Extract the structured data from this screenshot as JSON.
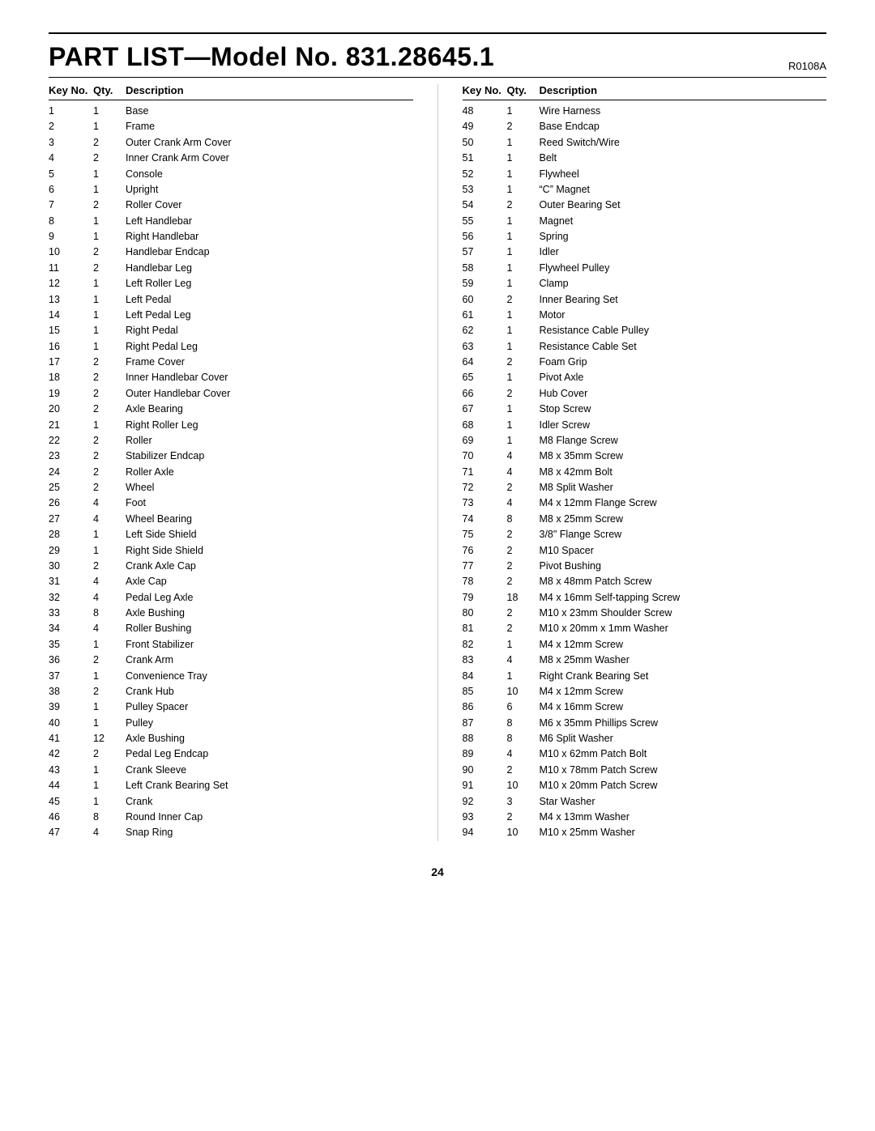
{
  "header": {
    "title": "PART LIST—Model No. 831.28645.1",
    "code": "R0108A"
  },
  "columns": {
    "key_no_label": "Key No.",
    "qty_label": "Qty.",
    "desc_label": "Description"
  },
  "left_parts": [
    {
      "key": "1",
      "qty": "1",
      "desc": "Base"
    },
    {
      "key": "2",
      "qty": "1",
      "desc": "Frame"
    },
    {
      "key": "3",
      "qty": "2",
      "desc": "Outer Crank Arm Cover"
    },
    {
      "key": "4",
      "qty": "2",
      "desc": "Inner Crank Arm Cover"
    },
    {
      "key": "5",
      "qty": "1",
      "desc": "Console"
    },
    {
      "key": "6",
      "qty": "1",
      "desc": "Upright"
    },
    {
      "key": "7",
      "qty": "2",
      "desc": "Roller Cover"
    },
    {
      "key": "8",
      "qty": "1",
      "desc": "Left Handlebar"
    },
    {
      "key": "9",
      "qty": "1",
      "desc": "Right Handlebar"
    },
    {
      "key": "10",
      "qty": "2",
      "desc": "Handlebar Endcap"
    },
    {
      "key": "11",
      "qty": "2",
      "desc": "Handlebar Leg"
    },
    {
      "key": "12",
      "qty": "1",
      "desc": "Left Roller Leg"
    },
    {
      "key": "13",
      "qty": "1",
      "desc": "Left Pedal"
    },
    {
      "key": "14",
      "qty": "1",
      "desc": "Left Pedal Leg"
    },
    {
      "key": "15",
      "qty": "1",
      "desc": "Right Pedal"
    },
    {
      "key": "16",
      "qty": "1",
      "desc": "Right Pedal Leg"
    },
    {
      "key": "17",
      "qty": "2",
      "desc": "Frame Cover"
    },
    {
      "key": "18",
      "qty": "2",
      "desc": "Inner Handlebar Cover"
    },
    {
      "key": "19",
      "qty": "2",
      "desc": "Outer Handlebar Cover"
    },
    {
      "key": "20",
      "qty": "2",
      "desc": "Axle Bearing"
    },
    {
      "key": "21",
      "qty": "1",
      "desc": "Right Roller Leg"
    },
    {
      "key": "22",
      "qty": "2",
      "desc": "Roller"
    },
    {
      "key": "23",
      "qty": "2",
      "desc": "Stabilizer Endcap"
    },
    {
      "key": "24",
      "qty": "2",
      "desc": "Roller Axle"
    },
    {
      "key": "25",
      "qty": "2",
      "desc": "Wheel"
    },
    {
      "key": "26",
      "qty": "4",
      "desc": "Foot"
    },
    {
      "key": "27",
      "qty": "4",
      "desc": "Wheel Bearing"
    },
    {
      "key": "28",
      "qty": "1",
      "desc": "Left Side Shield"
    },
    {
      "key": "29",
      "qty": "1",
      "desc": "Right Side Shield"
    },
    {
      "key": "30",
      "qty": "2",
      "desc": "Crank Axle Cap"
    },
    {
      "key": "31",
      "qty": "4",
      "desc": "Axle Cap"
    },
    {
      "key": "32",
      "qty": "4",
      "desc": "Pedal Leg Axle"
    },
    {
      "key": "33",
      "qty": "8",
      "desc": "Axle Bushing"
    },
    {
      "key": "34",
      "qty": "4",
      "desc": "Roller Bushing"
    },
    {
      "key": "35",
      "qty": "1",
      "desc": "Front Stabilizer"
    },
    {
      "key": "36",
      "qty": "2",
      "desc": "Crank Arm"
    },
    {
      "key": "37",
      "qty": "1",
      "desc": "Convenience Tray"
    },
    {
      "key": "38",
      "qty": "2",
      "desc": "Crank Hub"
    },
    {
      "key": "39",
      "qty": "1",
      "desc": "Pulley Spacer"
    },
    {
      "key": "40",
      "qty": "1",
      "desc": "Pulley"
    },
    {
      "key": "41",
      "qty": "12",
      "desc": "Axle Bushing"
    },
    {
      "key": "42",
      "qty": "2",
      "desc": "Pedal Leg Endcap"
    },
    {
      "key": "43",
      "qty": "1",
      "desc": "Crank Sleeve"
    },
    {
      "key": "44",
      "qty": "1",
      "desc": "Left Crank Bearing Set"
    },
    {
      "key": "45",
      "qty": "1",
      "desc": "Crank"
    },
    {
      "key": "46",
      "qty": "8",
      "desc": "Round Inner Cap"
    },
    {
      "key": "47",
      "qty": "4",
      "desc": "Snap Ring"
    }
  ],
  "right_parts": [
    {
      "key": "48",
      "qty": "1",
      "desc": "Wire Harness"
    },
    {
      "key": "49",
      "qty": "2",
      "desc": "Base Endcap"
    },
    {
      "key": "50",
      "qty": "1",
      "desc": "Reed Switch/Wire"
    },
    {
      "key": "51",
      "qty": "1",
      "desc": "Belt"
    },
    {
      "key": "52",
      "qty": "1",
      "desc": "Flywheel"
    },
    {
      "key": "53",
      "qty": "1",
      "desc": "“C” Magnet"
    },
    {
      "key": "54",
      "qty": "2",
      "desc": "Outer Bearing Set"
    },
    {
      "key": "55",
      "qty": "1",
      "desc": "Magnet"
    },
    {
      "key": "56",
      "qty": "1",
      "desc": "Spring"
    },
    {
      "key": "57",
      "qty": "1",
      "desc": "Idler"
    },
    {
      "key": "58",
      "qty": "1",
      "desc": "Flywheel Pulley"
    },
    {
      "key": "59",
      "qty": "1",
      "desc": "Clamp"
    },
    {
      "key": "60",
      "qty": "2",
      "desc": "Inner Bearing Set"
    },
    {
      "key": "61",
      "qty": "1",
      "desc": "Motor"
    },
    {
      "key": "62",
      "qty": "1",
      "desc": "Resistance Cable Pulley"
    },
    {
      "key": "63",
      "qty": "1",
      "desc": "Resistance Cable Set"
    },
    {
      "key": "64",
      "qty": "2",
      "desc": "Foam Grip"
    },
    {
      "key": "65",
      "qty": "1",
      "desc": "Pivot Axle"
    },
    {
      "key": "66",
      "qty": "2",
      "desc": "Hub Cover"
    },
    {
      "key": "67",
      "qty": "1",
      "desc": "Stop Screw"
    },
    {
      "key": "68",
      "qty": "1",
      "desc": "Idler Screw"
    },
    {
      "key": "69",
      "qty": "1",
      "desc": "M8 Flange Screw"
    },
    {
      "key": "70",
      "qty": "4",
      "desc": "M8 x 35mm Screw"
    },
    {
      "key": "71",
      "qty": "4",
      "desc": "M8 x 42mm Bolt"
    },
    {
      "key": "72",
      "qty": "2",
      "desc": "M8 Split Washer"
    },
    {
      "key": "73",
      "qty": "4",
      "desc": "M4 x 12mm Flange Screw"
    },
    {
      "key": "74",
      "qty": "8",
      "desc": "M8 x 25mm Screw"
    },
    {
      "key": "75",
      "qty": "2",
      "desc": "3/8\" Flange Screw"
    },
    {
      "key": "76",
      "qty": "2",
      "desc": "M10 Spacer"
    },
    {
      "key": "77",
      "qty": "2",
      "desc": "Pivot Bushing"
    },
    {
      "key": "78",
      "qty": "2",
      "desc": "M8 x 48mm Patch Screw"
    },
    {
      "key": "79",
      "qty": "18",
      "desc": "M4 x 16mm Self-tapping Screw"
    },
    {
      "key": "80",
      "qty": "2",
      "desc": "M10 x 23mm Shoulder Screw"
    },
    {
      "key": "81",
      "qty": "2",
      "desc": "M10 x 20mm x 1mm Washer"
    },
    {
      "key": "82",
      "qty": "1",
      "desc": "M4 x 12mm Screw"
    },
    {
      "key": "83",
      "qty": "4",
      "desc": "M8 x 25mm Washer"
    },
    {
      "key": "84",
      "qty": "1",
      "desc": "Right Crank Bearing Set"
    },
    {
      "key": "85",
      "qty": "10",
      "desc": "M4 x 12mm Screw"
    },
    {
      "key": "86",
      "qty": "6",
      "desc": "M4 x 16mm Screw"
    },
    {
      "key": "87",
      "qty": "8",
      "desc": "M6 x 35mm Phillips Screw"
    },
    {
      "key": "88",
      "qty": "8",
      "desc": "M6 Split Washer"
    },
    {
      "key": "89",
      "qty": "4",
      "desc": "M10 x 62mm Patch Bolt"
    },
    {
      "key": "90",
      "qty": "2",
      "desc": "M10 x 78mm Patch Screw"
    },
    {
      "key": "91",
      "qty": "10",
      "desc": "M10 x 20mm Patch Screw"
    },
    {
      "key": "92",
      "qty": "3",
      "desc": "Star Washer"
    },
    {
      "key": "93",
      "qty": "2",
      "desc": "M4 x 13mm Washer"
    },
    {
      "key": "94",
      "qty": "10",
      "desc": "M10 x 25mm Washer"
    }
  ],
  "footer": {
    "page_number": "24"
  }
}
